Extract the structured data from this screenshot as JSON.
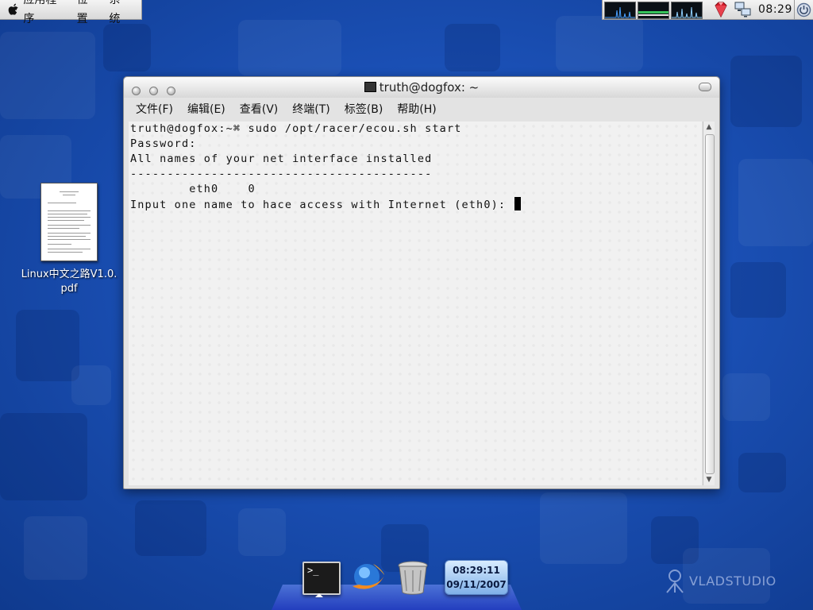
{
  "top_panel": {
    "menus": [
      "应用程序",
      "位置",
      "系统"
    ],
    "clock": "08:29"
  },
  "desktop": {
    "icon_label_line1": "Linux中文之路V1.0.",
    "icon_label_line2": "pdf"
  },
  "window": {
    "title": "truth@dogfox: ~",
    "menus": [
      "文件(F)",
      "编辑(E)",
      "查看(V)",
      "终端(T)",
      "标签(B)",
      "帮助(H)"
    ],
    "terminal_lines": [
      "truth@dogfox:~⌘ sudo /opt/racer/ecou.sh start",
      "Password:",
      "All names of your net interface installed",
      "-----------------------------------------",
      "        eth0    0",
      "Input one name to hace access with Internet (eth0): "
    ]
  },
  "dock": {
    "clock_time": "08:29:11",
    "clock_date": "09/11/2007"
  },
  "watermark": "VLADSTUDIO"
}
